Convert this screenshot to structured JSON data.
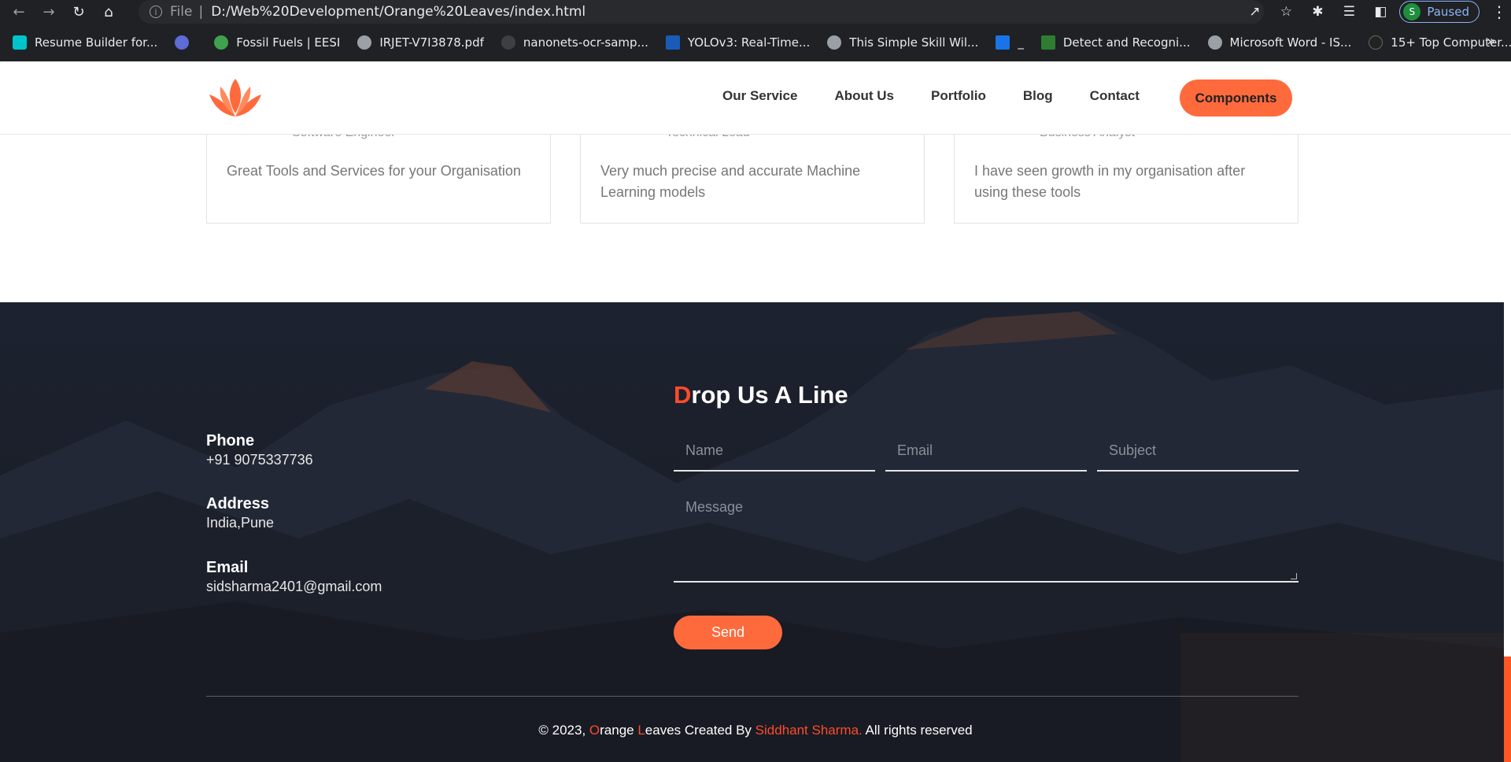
{
  "browser": {
    "url_prefix": "File",
    "url": "D:/Web%20Development/Orange%20Leaves/index.html",
    "profile_initial": "S",
    "profile_status": "Paused",
    "bookmarks": [
      {
        "label": "Resume Builder for...",
        "color": "#00c4cc"
      },
      {
        "label": "",
        "color": "#5f6bd6"
      },
      {
        "label": "Fossil Fuels | EESI",
        "color": "#3fa24f"
      },
      {
        "label": "IRJET-V7I3878.pdf",
        "color": "#9aa0a6"
      },
      {
        "label": "nanonets-ocr-samp...",
        "color": "#3c4043"
      },
      {
        "label": "YOLOv3: Real-Time...",
        "color": "#1a5bb8"
      },
      {
        "label": "This Simple Skill Wil...",
        "color": "#9aa0a6"
      },
      {
        "label": "_",
        "color": "#1a73e8"
      },
      {
        "label": "Detect and Recogni...",
        "color": "#2e7d32"
      },
      {
        "label": "Microsoft Word - IS...",
        "color": "#9aa0a6"
      },
      {
        "label": "15+ Top Computer...",
        "color": "#222"
      }
    ]
  },
  "header": {
    "nav": [
      "Our Service",
      "About Us",
      "Portfolio",
      "Blog",
      "Contact"
    ],
    "cta": "Components",
    "accent": "#ff6a3d"
  },
  "testimonials": [
    {
      "role": "Software Engineer",
      "quote": "Great Tools and Services for your Organisation"
    },
    {
      "role": "Technical Lead",
      "quote": "Very much precise and accurate Machine Learning models"
    },
    {
      "role": "Business Analyst",
      "quote": "I have seen growth in my organisation after using these tools"
    }
  ],
  "footer": {
    "title_first": "D",
    "title_rest": "rop Us A Line",
    "phone_label": "Phone",
    "phone": "+91 9075337736",
    "address_label": "Address",
    "address": "India,Pune",
    "email_label": "Email",
    "email": "sidsharma2401@gmail.com",
    "form": {
      "name_placeholder": "Name",
      "email_placeholder": "Email",
      "subject_placeholder": "Subject",
      "message_placeholder": "Message",
      "send": "Send"
    },
    "copyright_prefix": "© 2023, ",
    "brand_o": "O",
    "brand_range": "range ",
    "brand_l": "L",
    "brand_eaves": "eaves",
    "created_by": " Created By ",
    "author": "Siddhant Sharma.",
    "rights": " All rights reserved"
  }
}
